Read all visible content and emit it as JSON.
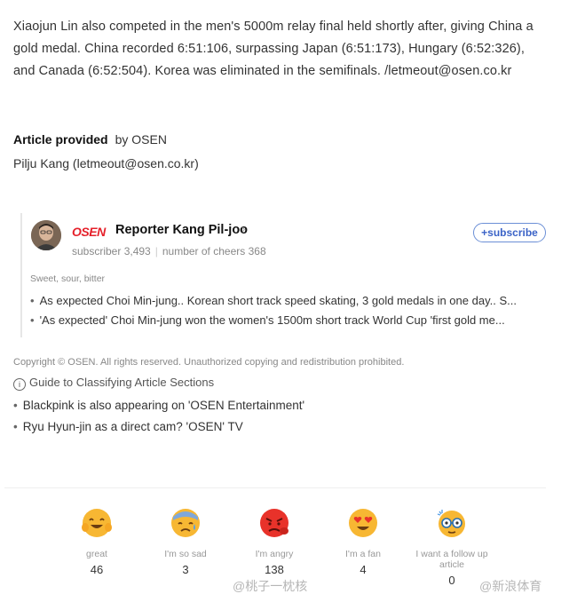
{
  "article": {
    "paragraph": "Xiaojun Lin also competed in the men's 5000m relay final held shortly after, giving China a gold medal. China recorded 6:51:106, surpassing Japan (6:51:173), Hungary (6:52:326), and Canada (6:52:504). Korea was eliminated in the semifinals. /letmeout@osen.co.kr",
    "provided_label": "Article provided",
    "provided_by": "by OSEN",
    "reporter_email_line": "Pilju Kang (letmeout@osen.co.kr)"
  },
  "reporter": {
    "logo": "OSEN",
    "name": "Reporter Kang Pil-joo",
    "chevron": "›",
    "subscriber_label": "subscriber",
    "subscriber_count": "3,493",
    "cheers_label": "number of cheers",
    "cheers_count": "368",
    "subscribe_label": "+subscribe",
    "section_label": "Sweet, sour, bitter",
    "related": [
      "As expected Choi Min-jung.. Korean short track speed skating, 3 gold medals in one day.. S...",
      "'As expected' Choi Min-jung won the women's 1500m short track World Cup 'first gold me..."
    ]
  },
  "footer": {
    "copyright": "Copyright © OSEN. All rights reserved. Unauthorized copying and redistribution prohibited.",
    "guide": "Guide to Classifying Article Sections",
    "links": [
      "Blackpink is also appearing on 'OSEN Entertainment'",
      "Ryu Hyun-jin as a direct cam? 'OSEN' TV"
    ]
  },
  "reactions": [
    {
      "label": "great",
      "count": "46",
      "icon": "happy-face-icon"
    },
    {
      "label": "I'm so sad",
      "count": "3",
      "icon": "sad-face-icon"
    },
    {
      "label": "I'm angry",
      "count": "138",
      "icon": "angry-face-icon"
    },
    {
      "label": "I'm a fan",
      "count": "4",
      "icon": "heart-eyes-icon"
    },
    {
      "label": "I want a follow up article",
      "count": "0",
      "icon": "glasses-face-icon"
    }
  ],
  "watermarks": [
    "@桃子一枕核",
    "@新浪体育"
  ],
  "colors": {
    "accent": "#3b63c7",
    "osen_red": "#e5202a",
    "emoji_yellow": "#f7b733",
    "emoji_red": "#e8322a"
  }
}
